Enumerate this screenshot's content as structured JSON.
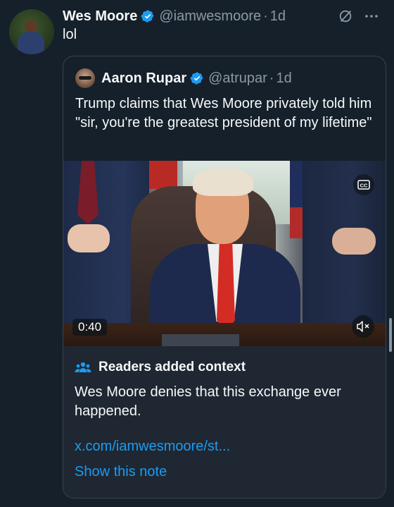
{
  "tweet": {
    "author_name": "Wes Moore",
    "author_handle": "@iamwesmoore",
    "separator": "·",
    "time": "1d",
    "text": "lol"
  },
  "quoted_tweet": {
    "author_name": "Aaron Rupar",
    "author_handle": "@atrupar",
    "separator": "·",
    "time": "1d",
    "text": "Trump claims that Wes Moore privately told him \"sir, you're the greatest president of my lifetime\""
  },
  "video": {
    "duration": "0:40",
    "captions_label": "CC"
  },
  "community_note": {
    "title": "Readers added context",
    "text": "Wes Moore denies that this exchange ever happened.",
    "link": "x.com/iamwesmoore/st...",
    "show_note": "Show this note"
  },
  "icons": {
    "verified": "verified-badge-icon",
    "grok": "grok-icon",
    "more": "more-icon",
    "captions": "cc-icon",
    "mute": "mute-icon",
    "people": "people-icon"
  },
  "colors": {
    "background": "#15202b",
    "accent": "#1d9bf0",
    "secondary_text": "#8b98a5",
    "note_panel": "#1e2732"
  }
}
